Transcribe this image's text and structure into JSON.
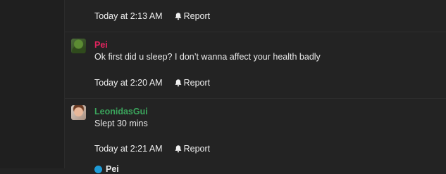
{
  "messages": [
    {
      "time": "Today at 2:13 AM",
      "report_label": "Report"
    },
    {
      "author": "Pei",
      "author_color": "#e0245e",
      "text": "Ok first did u sleep? I don’t wanna affect your health badly",
      "time": "Today at 2:20 AM",
      "report_label": "Report"
    },
    {
      "author": "LeonidasGui",
      "author_color": "#3ba55c",
      "text": "Slept 30 mins",
      "time": "Today at 2:21 AM",
      "report_label": "Report"
    }
  ],
  "next_author_partial": "Pei"
}
